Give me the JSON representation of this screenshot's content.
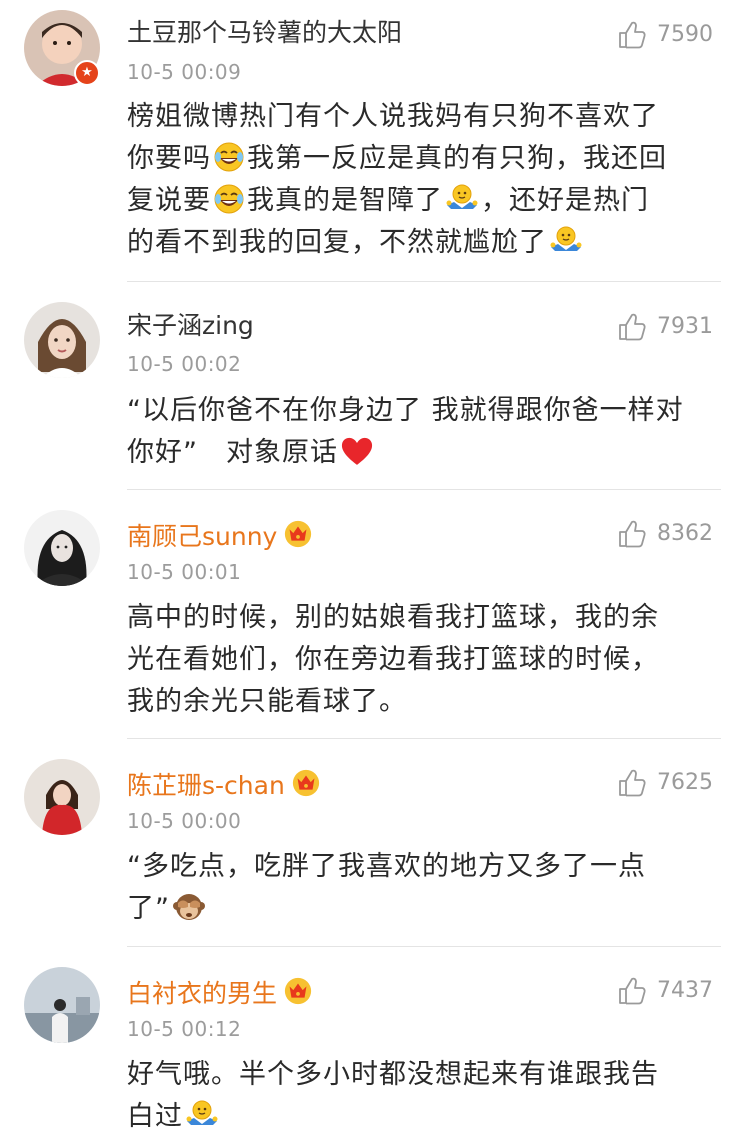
{
  "comments": [
    {
      "user": "土豆那个马铃薯的大太阳",
      "time": "10-5 00:09",
      "likes": "7590",
      "lines": [
        "榜姐微博热门有个人说我妈有只狗不喜欢了",
        "你要吗",
        "我第一反应是真的有只狗，我还回",
        "复说要",
        "我真的是智障了",
        "，还好是热门",
        "的看不到我的回复，不然就尴尬了"
      ],
      "verified_badge": "★"
    },
    {
      "user": "宋子涵zing",
      "time": "10-5 00:02",
      "likes": "7931",
      "lines": [
        "“以后你爸不在你身边了 我就得跟你爸一样对",
        "你好”　对象原话"
      ]
    },
    {
      "user": "南顾己sunny",
      "time": "10-5 00:01",
      "likes": "8362",
      "lines": [
        "高中的时候，别的姑娘看我打篮球，我的余",
        "光在看她们，你在旁边看我打篮球的时候，",
        "我的余光只能看球了。"
      ]
    },
    {
      "user": "陈芷珊s-chan",
      "time": "10-5 00:00",
      "likes": "7625",
      "lines": [
        "“多吃点，吃胖了我喜欢的地方又多了一点",
        "了”"
      ]
    },
    {
      "user": "白衬衣的男生",
      "time": "10-5 00:12",
      "likes": "7437",
      "lines": [
        "好气哦。半个多小时都没想起来有谁跟我告",
        "白过"
      ]
    }
  ],
  "colors": {
    "name_orange": "#e8761c",
    "name_default": "#333333",
    "time_gray": "#9c9c9c",
    "like_gray": "#9a9a9a",
    "divider": "#e4e4e4"
  },
  "icons": [
    "like-thumb-icon",
    "laugh-cry-emoji",
    "shrug-emoji",
    "heart-emoji",
    "see-no-evil-monkey-emoji",
    "vip-crown-icon"
  ]
}
